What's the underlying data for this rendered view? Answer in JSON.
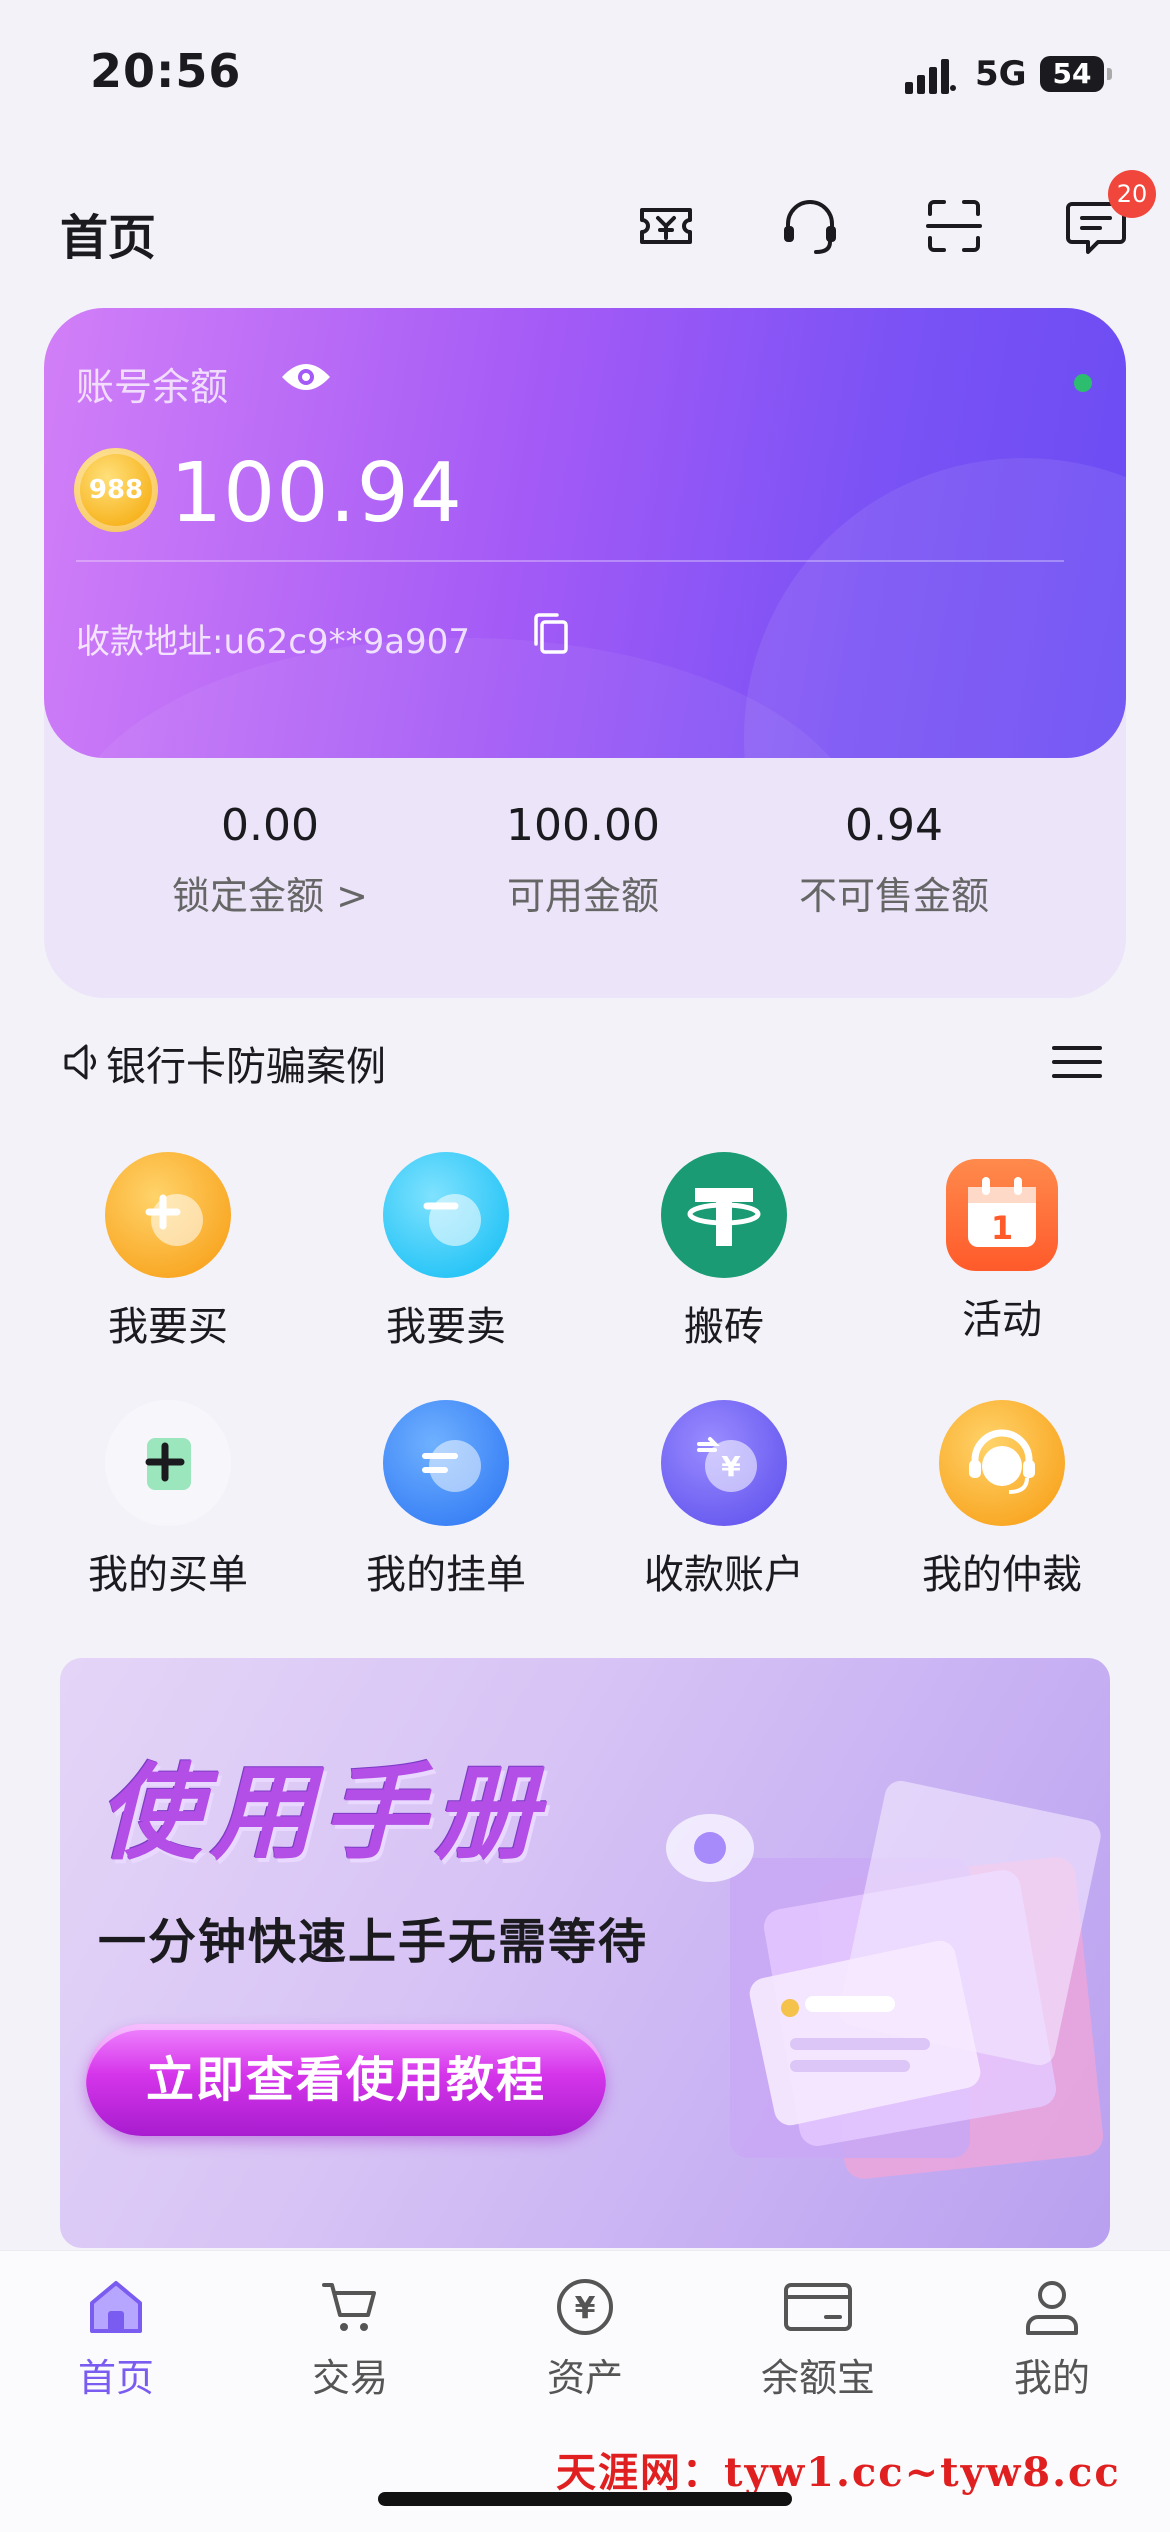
{
  "status_bar": {
    "time": "20:56",
    "network": "5G",
    "battery": "54"
  },
  "header": {
    "title": "首页",
    "message_badge": "20"
  },
  "balance": {
    "label": "账号余额",
    "amount": "100.94",
    "address": "收款地址:u62c9**9a907"
  },
  "stats": [
    {
      "value": "0.00",
      "label": "锁定金额 >"
    },
    {
      "value": "100.00",
      "label": "可用金额"
    },
    {
      "value": "0.94",
      "label": "不可售金额"
    }
  ],
  "notice": {
    "text": "银行卡防骗案例"
  },
  "grid": [
    {
      "label": "我要买",
      "icon": "plus-circle-icon",
      "color": "#f9a825"
    },
    {
      "label": "我要卖",
      "icon": "minus-circle-icon",
      "color": "#29c5f6"
    },
    {
      "label": "搬砖",
      "icon": "tether-icon",
      "color": "#1a9b73"
    },
    {
      "label": "活动",
      "icon": "calendar-icon",
      "color": "#ff6b35"
    },
    {
      "label": "我的买单",
      "icon": "buy-order-icon",
      "color": "#3bbf7b"
    },
    {
      "label": "我的挂单",
      "icon": "sell-order-icon",
      "color": "#3b82f6"
    },
    {
      "label": "收款账户",
      "icon": "receive-account-icon",
      "color": "#6a5cf0"
    },
    {
      "label": "我的仲裁",
      "icon": "support-agent-icon",
      "color": "#f9a825"
    }
  ],
  "banner": {
    "title": "使用手册",
    "subtitle": "一分钟快速上手无需等待",
    "button": "立即查看使用教程"
  },
  "tabs": [
    {
      "label": "首页",
      "icon": "home-icon",
      "active": true
    },
    {
      "label": "交易",
      "icon": "cart-icon",
      "active": false
    },
    {
      "label": "资产",
      "icon": "yuan-icon",
      "active": false
    },
    {
      "label": "余额宝",
      "icon": "wallet-card-icon",
      "active": false
    },
    {
      "label": "我的",
      "icon": "profile-icon",
      "active": false
    }
  ],
  "watermark": "天涯网：tyw1.cc~tyw8.cc",
  "colors": {
    "accent": "#7a5cf0",
    "card_start": "#d27ff7",
    "card_end": "#6a4cf3",
    "badge": "#f0463c"
  }
}
